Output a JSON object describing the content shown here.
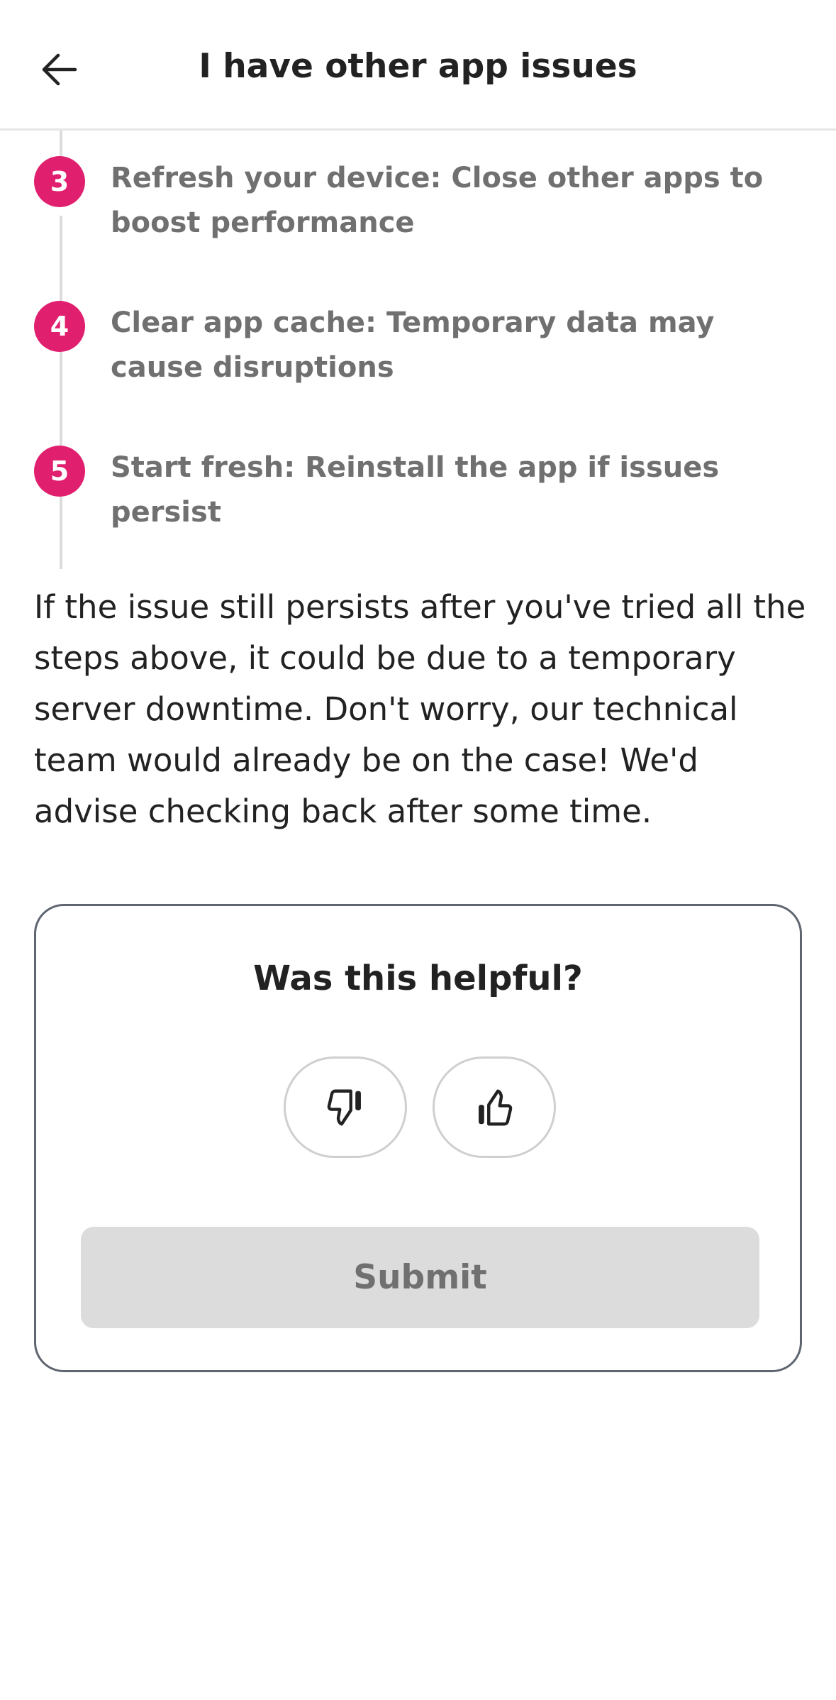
{
  "header": {
    "title": "I have other app issues",
    "back_icon": "arrow-left-icon"
  },
  "steps": [
    {
      "number": "3",
      "text": "Refresh your device: Close other apps to boost performance"
    },
    {
      "number": "4",
      "text": "Clear app cache: Temporary data may cause disruptions"
    },
    {
      "number": "5",
      "text": "Start fresh: Reinstall the app if issues persist"
    }
  ],
  "info_text": "If the issue still persists after you've tried all the steps above, it could be due to a temporary server downtime. Don't worry, our technical team would already be on the case! We'd advise checking back after some time.",
  "feedback": {
    "title": "Was this helpful?",
    "thumbs_down_icon": "thumbs-down-icon",
    "thumbs_up_icon": "thumbs-up-icon",
    "submit_label": "Submit"
  },
  "colors": {
    "accent": "#e0206f",
    "step_text": "#707070",
    "submit_disabled_bg": "#dcdcdc"
  }
}
